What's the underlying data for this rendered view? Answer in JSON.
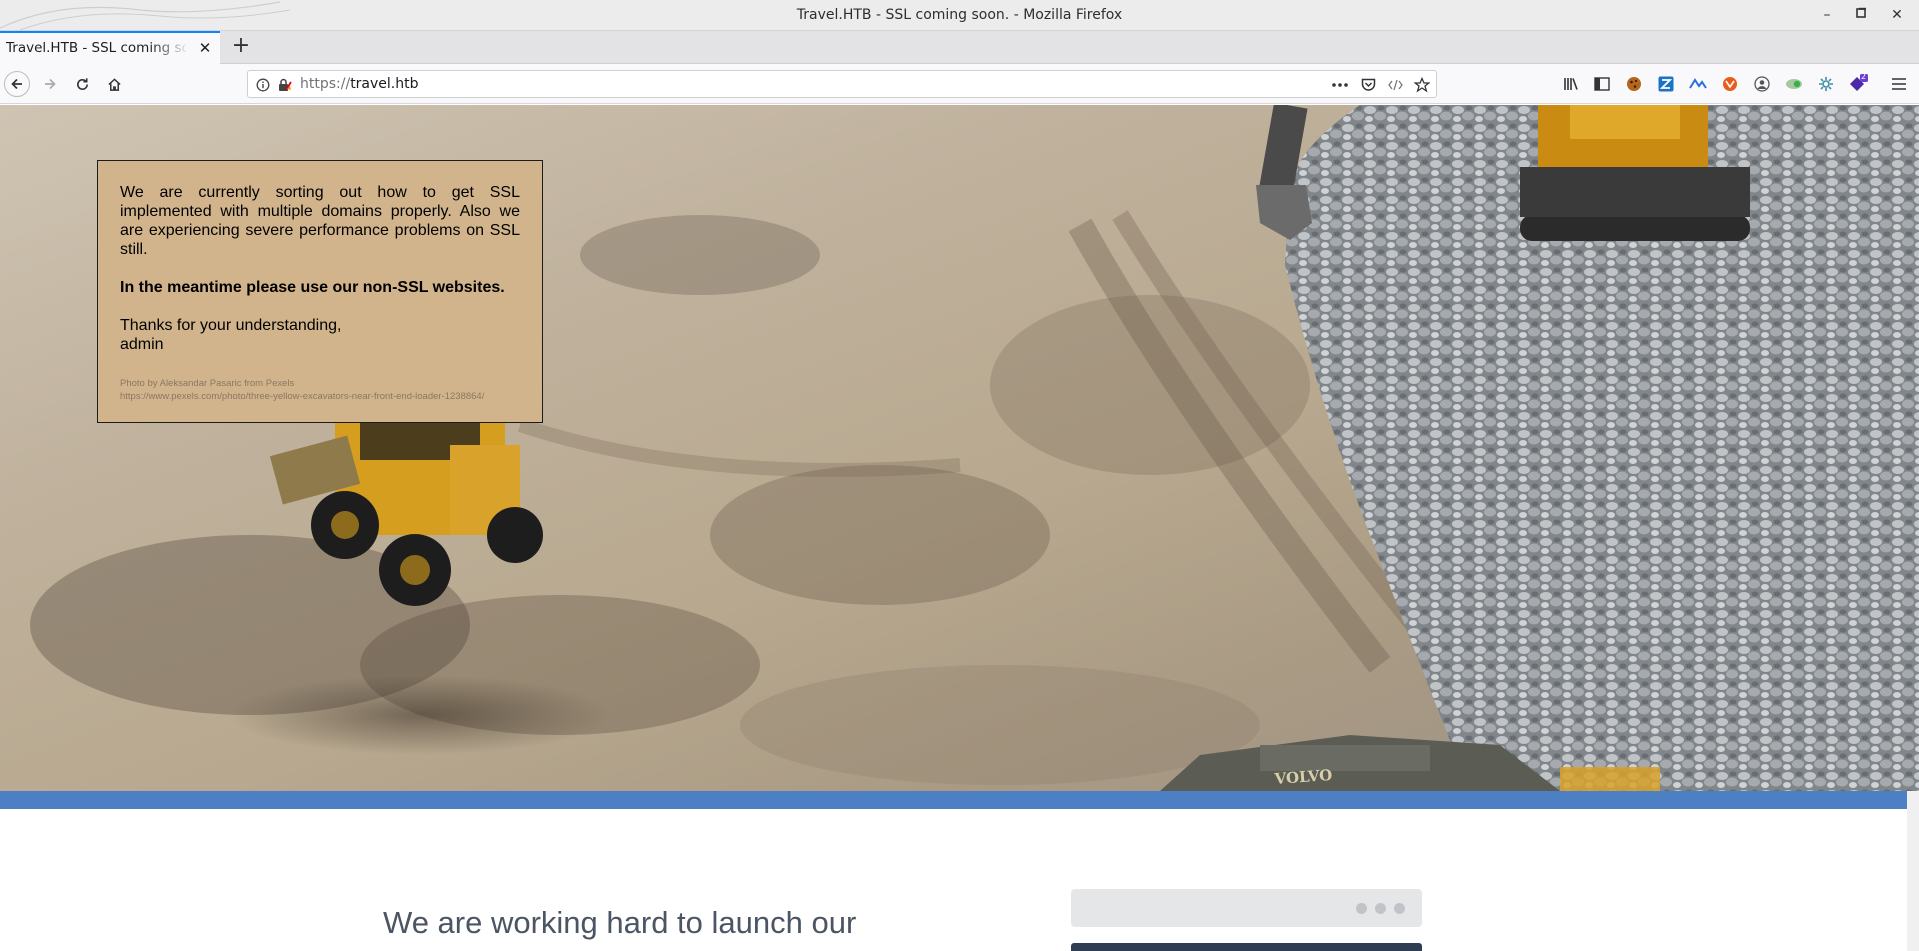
{
  "window": {
    "title": "Travel.HTB - SSL coming soon. - Mozilla Firefox"
  },
  "tabs": [
    {
      "label": "Travel.HTB - SSL coming soon.",
      "active": true
    }
  ],
  "urlbar": {
    "protocol": "https://",
    "host": "travel.htb"
  },
  "notice": {
    "paragraph1": "We are currently sorting out how to get SSL implemented with multiple domains properly. Also we are experiencing severe performance problems on SSL still.",
    "paragraph2": "In the meantime please use our non-SSL websites.",
    "thanks": "Thanks for your understanding,",
    "signature": "admin",
    "credit_line1": "Photo by Aleksandar Pasaric from Pexels",
    "credit_line2": "https://www.pexels.com/photo/three-yellow-excavators-near-front-end-loader-1238864/"
  },
  "launch": {
    "heading": "We are working hard to launch our"
  },
  "hero_image": {
    "brand_text": "VOLVO"
  },
  "extensions": {
    "notification_count": "2"
  },
  "colors": {
    "accent_blue": "#0a84ff",
    "notice_bg": "#d2b48c",
    "band_blue": "#4d7fc4"
  },
  "icons": [
    "back-icon",
    "forward-icon",
    "reload-icon",
    "home-icon",
    "info-icon",
    "insecure-lock-icon",
    "page-actions-icon",
    "pocket-icon",
    "reader-icon",
    "bookmark-star-icon",
    "library-icon",
    "sidebar-icon",
    "cookie-icon",
    "extension-icon",
    "menu-icon"
  ]
}
